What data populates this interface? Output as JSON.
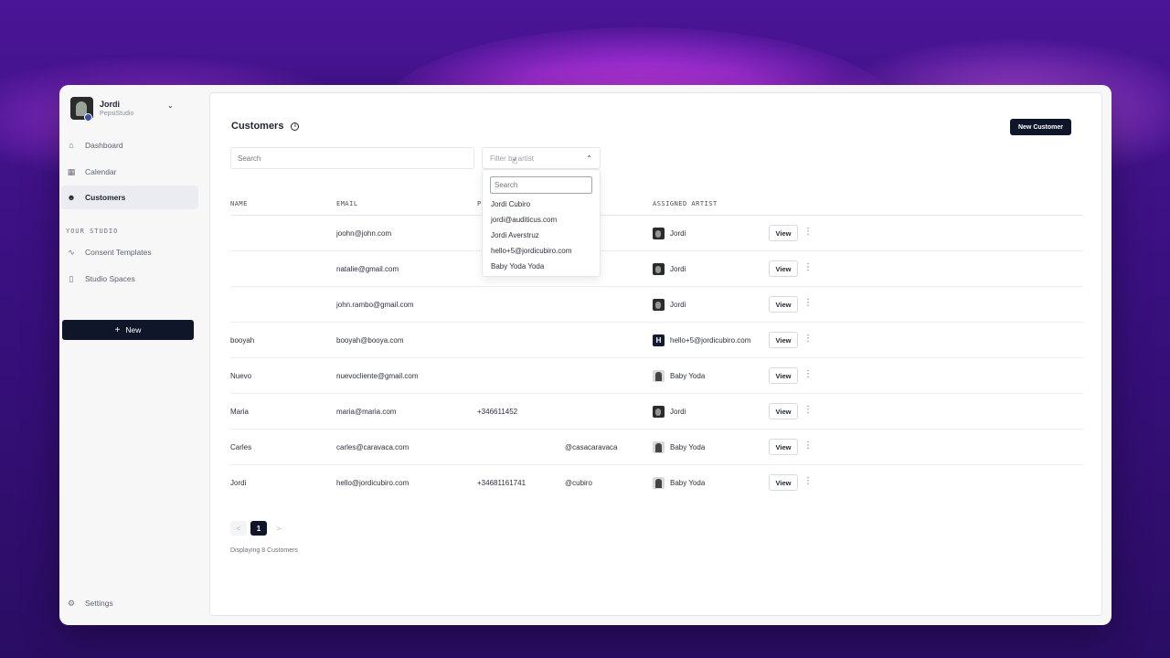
{
  "studio": {
    "name": "Jordi",
    "subtitle": "PepsiStudio"
  },
  "nav": {
    "items": [
      {
        "label": "Dashboard",
        "icon": "home-icon"
      },
      {
        "label": "Calendar",
        "icon": "calendar-icon"
      },
      {
        "label": "Customers",
        "icon": "user-plus-icon",
        "active": true
      }
    ],
    "section_label": "YOUR STUDIO",
    "studio_items": [
      {
        "label": "Consent Templates",
        "icon": "signature-icon"
      },
      {
        "label": "Studio Spaces",
        "icon": "door-icon"
      }
    ],
    "new_label": "New",
    "settings_label": "Settings"
  },
  "page": {
    "title": "Customers",
    "new_customer_label": "New Customer",
    "search_placeholder": "Search",
    "filter_placeholder": "Filter by artist"
  },
  "table": {
    "headers": [
      "NAME",
      "EMAIL",
      "P",
      "ASSIGNED ARTIST"
    ],
    "rows": [
      {
        "name": "",
        "email": "joohn@john.com",
        "phone": "",
        "social": "",
        "artist": "Jordi",
        "avatar": "jordi"
      },
      {
        "name": "",
        "email": "natalie@gmail.com",
        "phone": "",
        "social": "",
        "artist": "Jordi",
        "avatar": "jordi"
      },
      {
        "name": "",
        "email": "john.rambo@gmail.com",
        "phone": "",
        "social": "",
        "artist": "Jordi",
        "avatar": "jordi"
      },
      {
        "name": "booyah",
        "email": "booyah@booya.com",
        "phone": "",
        "social": "",
        "artist": "hello+5@jordicubiro.com",
        "avatar": "h"
      },
      {
        "name": "Nuevo",
        "email": "nuevocliente@gmail.com",
        "phone": "",
        "social": "",
        "artist": "Baby Yoda",
        "avatar": "baby"
      },
      {
        "name": "Maria",
        "email": "maria@maria.com",
        "phone": "+346611452",
        "social": "",
        "artist": "Jordi",
        "avatar": "jordi"
      },
      {
        "name": "Carles",
        "email": "carles@caravaca.com",
        "phone": "",
        "social": "@casacaravaca",
        "artist": "Baby Yoda",
        "avatar": "baby"
      },
      {
        "name": "Jordi",
        "email": "hello@jordicubiro.com",
        "phone": "+34681161741",
        "social": "@cubiro",
        "artist": "Baby Yoda",
        "avatar": "baby"
      }
    ],
    "view_label": "View",
    "h_avatar_letter": "H"
  },
  "dropdown": {
    "search_placeholder": "Search",
    "options": [
      "Jordi Cubiro",
      "jordi@auditicus.com",
      "Jordi Averstruz",
      "hello+5@jordicubiro.com",
      "Baby Yoda Yoda"
    ]
  },
  "pagination": {
    "prev": "<",
    "current": "1",
    "next": ">",
    "summary": "Displaying 8 Customers"
  },
  "colors": {
    "accent": "#0f1629",
    "background_purple": "#3a1080"
  }
}
